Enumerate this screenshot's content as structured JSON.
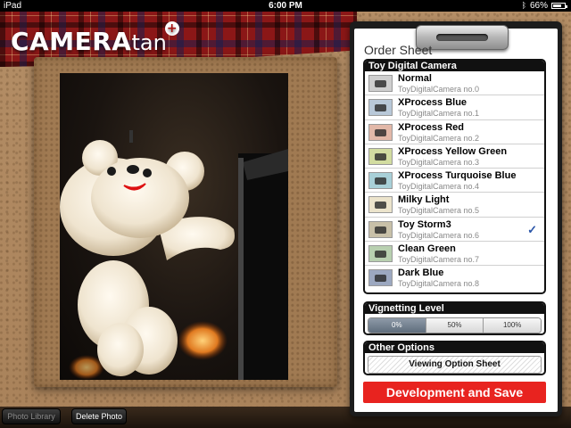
{
  "status_bar": {
    "device": "iPad",
    "time": "6:00 PM",
    "battery": "66%"
  },
  "app": {
    "logo_main": "CAMERA",
    "logo_sub": "tan",
    "logo_plus": "+"
  },
  "bottom_bar": {
    "photo_library": "Photo Library",
    "delete_photo": "Delete Photo"
  },
  "order_sheet": {
    "title": "Order Sheet",
    "filter_section": {
      "heading": "Toy Digital Camera",
      "items": [
        {
          "name": "Normal",
          "sub": "ToyDigitalCamera no.0",
          "tint": "#cfcfcf",
          "checked": false
        },
        {
          "name": "XProcess Blue",
          "sub": "ToyDigitalCamera no.1",
          "tint": "#b8c8d8",
          "checked": false
        },
        {
          "name": "XProcess Red",
          "sub": "ToyDigitalCamera no.2",
          "tint": "#e2b8a8",
          "checked": false
        },
        {
          "name": "XProcess Yellow Green",
          "sub": "ToyDigitalCamera no.3",
          "tint": "#d2dca0",
          "checked": false
        },
        {
          "name": "XProcess Turquoise Blue",
          "sub": "ToyDigitalCamera no.4",
          "tint": "#a8d0d8",
          "checked": false
        },
        {
          "name": "Milky Light",
          "sub": "ToyDigitalCamera no.5",
          "tint": "#ece4cc",
          "checked": false
        },
        {
          "name": "Toy Storm3",
          "sub": "ToyDigitalCamera no.6",
          "tint": "#c8c0a8",
          "checked": true
        },
        {
          "name": "Clean Green",
          "sub": "ToyDigitalCamera no.7",
          "tint": "#b8d0b0",
          "checked": false
        },
        {
          "name": "Dark Blue",
          "sub": "ToyDigitalCamera no.8",
          "tint": "#9ca8c0",
          "checked": false
        }
      ],
      "check_mark": "✓"
    },
    "vignetting": {
      "heading": "Vignetting Level",
      "options": [
        "0%",
        "50%",
        "100%"
      ],
      "selected": "0%"
    },
    "other_options": {
      "heading": "Other Options",
      "viewing_button": "Viewing Option Sheet"
    },
    "develop_button": "Development and Save"
  },
  "colors": {
    "accent_red": "#e8231f",
    "check_blue": "#2a55a8"
  }
}
